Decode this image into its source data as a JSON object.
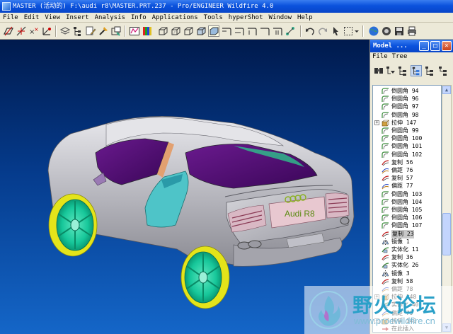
{
  "window": {
    "title": "MASTER (活动的) F:\\audi r8\\MASTER.PRT.237 - Pro/ENGINEER Wildfire 4.0"
  },
  "menu": [
    "File",
    "Edit",
    "View",
    "Insert",
    "Analysis",
    "Info",
    "Applications",
    "Tools",
    "hyperShot",
    "Window",
    "Help"
  ],
  "model": {
    "badge_text": "Audi R8"
  },
  "panel": {
    "title": "Model ...",
    "menu": [
      "File",
      "Tree"
    ],
    "window_buttons": [
      "_",
      "□",
      "×"
    ]
  },
  "tree": [
    {
      "label": "倒圆角 94",
      "icon": "round",
      "exp": ""
    },
    {
      "label": "倒圆角 96",
      "icon": "round",
      "exp": ""
    },
    {
      "label": "倒圆角 97",
      "icon": "round",
      "exp": ""
    },
    {
      "label": "倒圆角 98",
      "icon": "round",
      "exp": ""
    },
    {
      "label": "拉伸 147",
      "icon": "extrude",
      "exp": "+"
    },
    {
      "label": "倒圆角 99",
      "icon": "round",
      "exp": ""
    },
    {
      "label": "倒圆角 100",
      "icon": "round",
      "exp": ""
    },
    {
      "label": "倒圆角 101",
      "icon": "round",
      "exp": ""
    },
    {
      "label": "倒圆角 102",
      "icon": "round",
      "exp": ""
    },
    {
      "label": "复制 56",
      "icon": "copy",
      "exp": ""
    },
    {
      "label": "偏距 76",
      "icon": "offset",
      "exp": ""
    },
    {
      "label": "复制 57",
      "icon": "copy",
      "exp": ""
    },
    {
      "label": "偏距 77",
      "icon": "offset",
      "exp": ""
    },
    {
      "label": "倒圆角 103",
      "icon": "round",
      "exp": ""
    },
    {
      "label": "倒圆角 104",
      "icon": "round",
      "exp": ""
    },
    {
      "label": "倒圆角 105",
      "icon": "round",
      "exp": ""
    },
    {
      "label": "倒圆角 106",
      "icon": "round",
      "exp": ""
    },
    {
      "label": "倒圆角 107",
      "icon": "round",
      "exp": ""
    },
    {
      "label": "复制 23",
      "icon": "copy",
      "exp": "",
      "highlight": true
    },
    {
      "label": "镜像 1",
      "icon": "mirror",
      "exp": ""
    },
    {
      "label": "实体化 11",
      "icon": "solid",
      "exp": ""
    },
    {
      "label": "复制 36",
      "icon": "copy",
      "exp": ""
    },
    {
      "label": "实体化 26",
      "icon": "solid",
      "exp": ""
    },
    {
      "label": "镜像 3",
      "icon": "mirror",
      "exp": ""
    },
    {
      "label": "复制 58",
      "icon": "copy",
      "exp": ""
    },
    {
      "label": "偏距 78",
      "icon": "offset",
      "exp": ""
    },
    {
      "label": "拉伸 148",
      "icon": "extrude",
      "exp": "+"
    },
    {
      "label": "实体化 40",
      "icon": "solid",
      "exp": ""
    },
    {
      "label": "偏距 79",
      "icon": "offset",
      "exp": ""
    },
    {
      "label": "拉伸 149",
      "icon": "extrude",
      "exp": "+"
    },
    {
      "label": "在此插入",
      "icon": "insert",
      "exp": ""
    }
  ],
  "watermark": {
    "chinese": "野火论坛",
    "url": "www.proewildfire.cn"
  },
  "colors": {
    "titlebar": "#0a52dd",
    "viewport_top": "#001a4d",
    "viewport_bottom": "#1466c8",
    "car_body": "#c8c8cc",
    "glass": "#4a0a6e",
    "wheel_green": "#17c79a",
    "tire_yellow": "#e4e41a"
  }
}
